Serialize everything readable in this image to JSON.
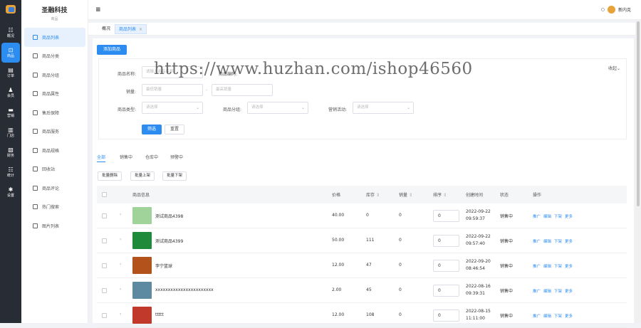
{
  "rail": [
    {
      "icon": "overview-icon",
      "glyph": "☷",
      "label": "概况"
    },
    {
      "icon": "goods-icon",
      "glyph": "⊡",
      "label": "商品",
      "active": true
    },
    {
      "icon": "order-icon",
      "glyph": "▤",
      "label": "订单"
    },
    {
      "icon": "user-icon",
      "glyph": "♟",
      "label": "会员"
    },
    {
      "icon": "marketing-icon",
      "glyph": "▬",
      "label": "营销"
    },
    {
      "icon": "store-icon",
      "glyph": "▥",
      "label": "门店"
    },
    {
      "icon": "finance-icon",
      "glyph": "▧",
      "label": "财务"
    },
    {
      "icon": "stats-icon",
      "glyph": "☷",
      "label": "统计"
    },
    {
      "icon": "settings-icon",
      "glyph": "✱",
      "label": "设置"
    }
  ],
  "sidebar": {
    "title": "圣融科技",
    "subtitle": "商品",
    "items": [
      {
        "label": "商品列表",
        "active": true
      },
      {
        "label": "商品分类"
      },
      {
        "label": "商品分组"
      },
      {
        "label": "商品属性"
      },
      {
        "label": "售后保障"
      },
      {
        "label": "商品服务"
      },
      {
        "label": "商品规格"
      },
      {
        "label": "回收站"
      },
      {
        "label": "商品评论"
      },
      {
        "label": "热门搜索"
      },
      {
        "label": "图片列表"
      }
    ]
  },
  "topbar": {
    "menu_glyph": "≡",
    "user_name": "新内克"
  },
  "tabs": [
    {
      "label": "概况"
    },
    {
      "label": "商品列表",
      "close": "×"
    }
  ],
  "toolbar": {
    "add_label": "添加商品"
  },
  "watermark": "https://www.huzhan.com/ishop46560",
  "filter": {
    "name_label": "商品名称:",
    "name_placeholder": "请输入商品名称",
    "code_label": "商品编码:",
    "sales_label": "销量:",
    "sales_min_placeholder": "最低销量",
    "sales_max_placeholder": "最高销量",
    "range_sep": "-",
    "type_label": "商品类型:",
    "group_label": "商品分组:",
    "activity_label": "营销活动:",
    "select_placeholder": "请选择",
    "collapse_label": "收起",
    "search_label": "筛选",
    "reset_label": "重置"
  },
  "status_tabs": [
    "全部",
    "销售中",
    "仓库中",
    "预警中"
  ],
  "batch": [
    "批量删除",
    "批量上架",
    "批量下架"
  ],
  "table": {
    "headers": {
      "info": "商品信息",
      "price": "价格",
      "stock": "库存",
      "sales": "销量",
      "sort": "排序",
      "created": "创建时间",
      "status": "状态",
      "ops": "操作"
    },
    "sort_glyph": "⇕",
    "rows": [
      {
        "name": "测试商品4398",
        "price": "40.00",
        "stock": "0",
        "sales": "0",
        "sort": "0",
        "date": "2022-09-22",
        "time": "09:59:37",
        "status": "销售中",
        "thumb": "#9fd39a"
      },
      {
        "name": "测试商品4399",
        "price": "50.00",
        "stock": "111",
        "sales": "0",
        "sort": "0",
        "date": "2022-09-22",
        "time": "09:57:40",
        "status": "销售中",
        "thumb": "#1f8a3a"
      },
      {
        "name": "李宁篮球",
        "price": "12.00",
        "stock": "47",
        "sales": "0",
        "sort": "0",
        "date": "2022-09-20",
        "time": "08:46:54",
        "status": "销售中",
        "thumb": "#b4521c"
      },
      {
        "name": "xxxxxxxxxxxxxxxxxxxxxxx",
        "price": "2.00",
        "stock": "45",
        "sales": "0",
        "sort": "0",
        "date": "2022-08-16",
        "time": "09:39:31",
        "status": "销售中",
        "thumb": "#5d8aa0"
      },
      {
        "name": "ttttt",
        "price": "12.00",
        "stock": "108",
        "sales": "0",
        "sort": "0",
        "date": "2022-08-15",
        "time": "11:11:00",
        "status": "销售中",
        "thumb": "#c0392b"
      }
    ],
    "ops": [
      "推广",
      "编辑",
      "下架",
      "更多"
    ],
    "expand_glyph": "›"
  }
}
